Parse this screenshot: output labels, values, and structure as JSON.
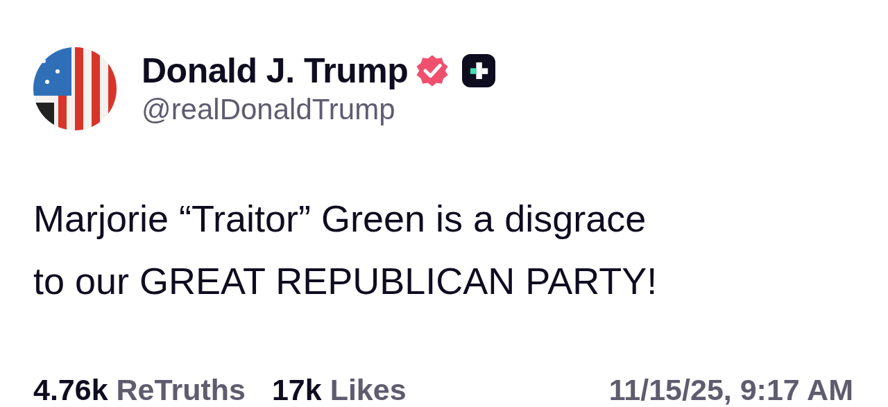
{
  "author": {
    "name": "Donald J. Trump",
    "handle": "@realDonaldTrump",
    "verified": true,
    "badge": true
  },
  "post": {
    "lines": [
      "Marjorie “Traitor” Green is a disgrace",
      "to our GREAT REPUBLICAN PARTY!"
    ]
  },
  "stats": [
    {
      "count": "4.76k",
      "label": "ReTruths"
    },
    {
      "count": "17k",
      "label": "Likes"
    }
  ],
  "timestamp": "11/15/25, 9:17 AM"
}
